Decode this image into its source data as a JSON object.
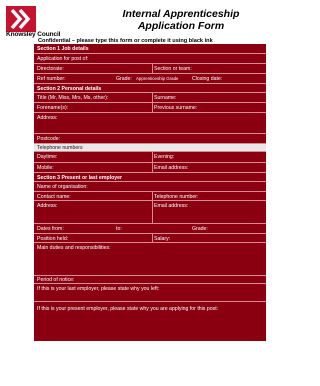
{
  "header": {
    "logo_text": "Knowsley Council",
    "title_line1": "Internal Apprenticeship",
    "title_line2": "Application Form",
    "confidential": "Confidential – please type this form or complete it using black ink"
  },
  "form": {
    "section1": {
      "heading": "Section 1  Job details",
      "application_for_post": "Application for post of:",
      "directorate": "Directorate:",
      "section_or_team": "Section or team:",
      "ref_number": "Ref number:",
      "grade": "Grade:",
      "grade_value": "Apprenticeship Grade",
      "closing_date": "Closing date:"
    },
    "section2": {
      "heading": "Section 2  Personal details",
      "title": "Title (Mr, Miss, Mrs, Ms, other):",
      "surname": "Surname:",
      "forenames": "Forename(s):",
      "previous_surname": "Previous surname:",
      "address": "Address:",
      "postcode": "Postcode:",
      "telephone_numbers": "Telephone numbers",
      "daytime": "Daytime:",
      "evening": "Evening:",
      "mobile": "Mobile:",
      "email": "Email address:"
    },
    "section3": {
      "heading": "Section 3  Present or last employer",
      "name_of_org": "Name of organisation:",
      "contact_name": "Contact name:",
      "telephone_number": "Telephone number:",
      "address": "Address:",
      "email": "Email address:",
      "dates_from": "Dates from:",
      "to": "to:",
      "grade": "Grade:",
      "position_held": "Position held:",
      "salary": "Salary:",
      "main_duties": "Main duties and responsibilities:",
      "period_of_notice": "Period of notice:",
      "why_left": "If this is your last employer, please state why you left:",
      "why_applying": "If this is your present employer, please state why you are applying for this post:"
    }
  }
}
